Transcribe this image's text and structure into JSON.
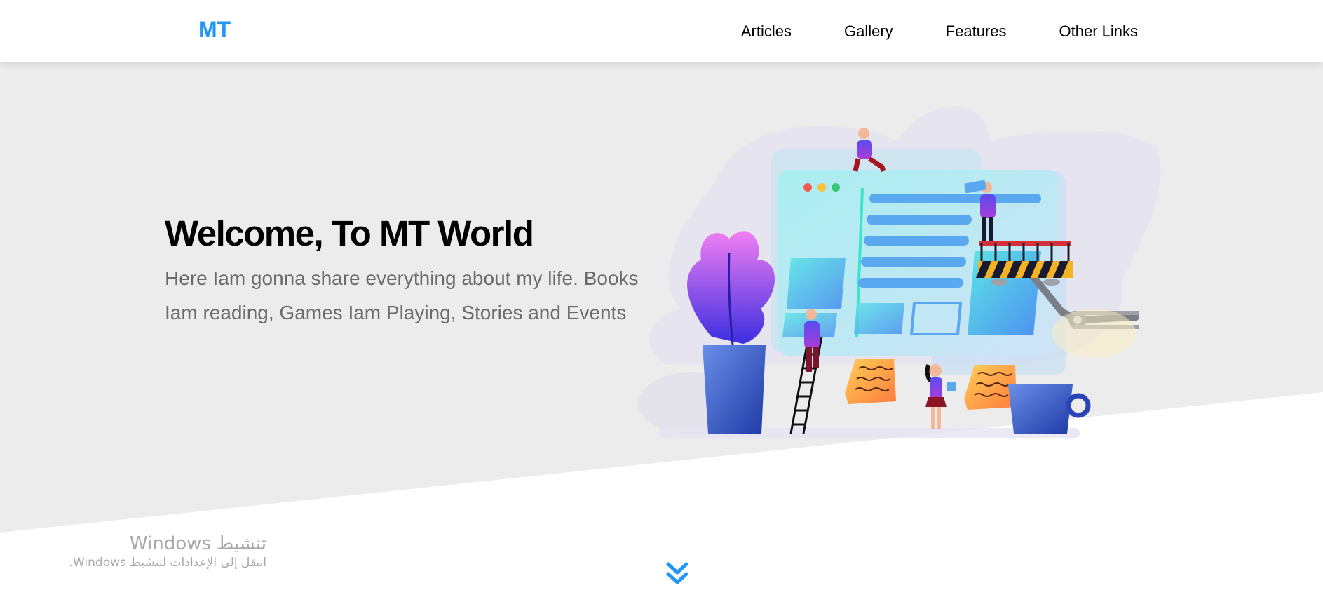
{
  "header": {
    "logo": "MT",
    "nav": [
      {
        "label": "Articles"
      },
      {
        "label": "Gallery"
      },
      {
        "label": "Features"
      },
      {
        "label": "Other Links"
      }
    ]
  },
  "hero": {
    "title": "Welcome, To MT World",
    "description": "Here Iam gonna share everything about my life. Books Iam reading, Games Iam Playing, Stories and Events",
    "illustration_icon": "web-development-team-illustration"
  },
  "scroll_down": {
    "icon": "double-chevron-down-icon"
  },
  "watermark": {
    "title": "تنشيط Windows",
    "subtitle": "انتقل إلى الإعدادات لتنشيط Windows."
  },
  "colors": {
    "brand": "#2196f3",
    "hero_background": "#ececec",
    "text_muted": "#6b6b6b",
    "heading": "#000000"
  }
}
